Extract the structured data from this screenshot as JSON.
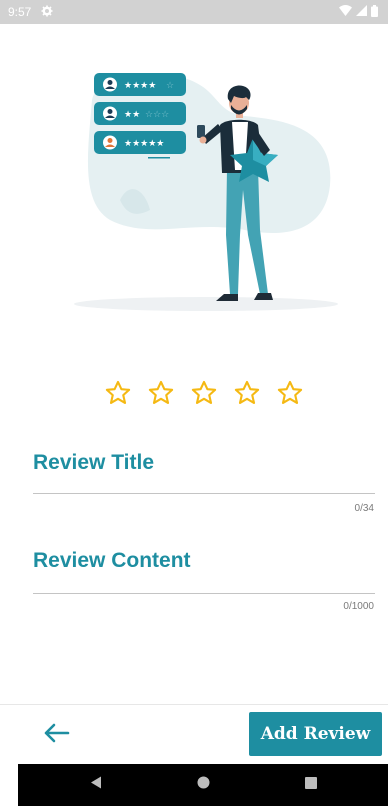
{
  "status_bar": {
    "time": "9:57",
    "icons": [
      "settings-icon",
      "wifi-icon",
      "signal-icon",
      "battery-icon"
    ]
  },
  "illustration": {
    "subject": "person-holding-star-with-review-cards",
    "review_cards": [
      {
        "stars": 4
      },
      {
        "stars": 2
      },
      {
        "stars": 5
      }
    ]
  },
  "rating": {
    "max_stars": 5,
    "selected": 0,
    "star_color": "#f5b913"
  },
  "form": {
    "title_label": "Review Title",
    "title_counter": "0/34",
    "content_label": "Review Content",
    "content_counter": "0/1000"
  },
  "actions": {
    "back_icon": "arrow-left-icon",
    "add_review_label": "Add Review"
  },
  "nav": {
    "buttons": [
      "back-triangle-icon",
      "home-circle-icon",
      "recents-square-icon"
    ]
  },
  "colors": {
    "accent": "#1e8ea1",
    "status_bar_bg": "#d2d2d2",
    "nav_bar_bg": "#000000",
    "star": "#f5b913"
  }
}
